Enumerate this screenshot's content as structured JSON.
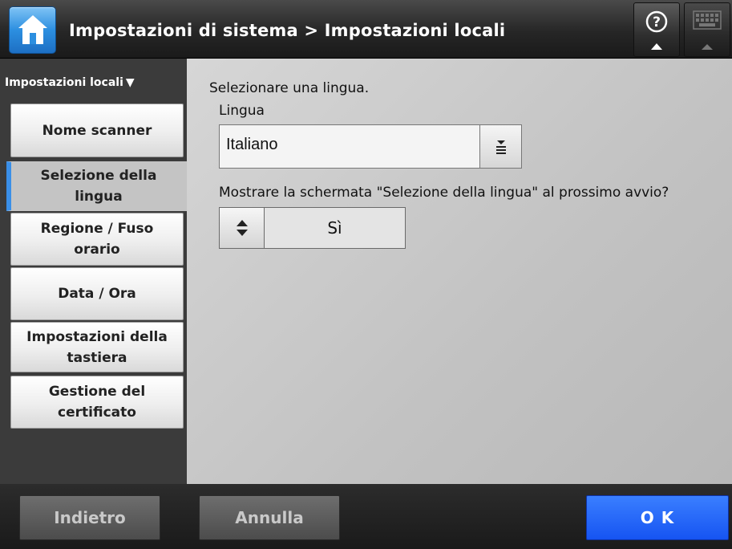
{
  "header": {
    "title": "Impostazioni di sistema > Impostazioni locali",
    "home_icon": "home-icon",
    "help_icon": "help-icon",
    "keyboard_icon": "keyboard-icon",
    "accent_color": "#2c8fe0"
  },
  "sidebar": {
    "heading": "Impostazioni locali",
    "heading_indicator": "▼",
    "selected_color": "#3a8fe8",
    "items": [
      {
        "label": "Nome scanner",
        "selected": false
      },
      {
        "label": "Selezione della lingua",
        "selected": true
      },
      {
        "label": "Regione / Fuso orario",
        "selected": false
      },
      {
        "label": "Data / Ora",
        "selected": false
      },
      {
        "label": "Impostazioni della tastiera",
        "selected": false
      },
      {
        "label": "Gestione del certificato",
        "selected": false
      }
    ]
  },
  "main": {
    "instruction": "Selezionare una lingua.",
    "language_label": "Lingua",
    "language_value": "Italiano",
    "startup_question": "Mostrare la schermata \"Selezione della lingua\" al prossimo avvio?",
    "startup_value": "Sì"
  },
  "footer": {
    "back_label": "Indietro",
    "cancel_label": "Annulla",
    "ok_label": "O K",
    "ok_color": "#1654f2"
  }
}
